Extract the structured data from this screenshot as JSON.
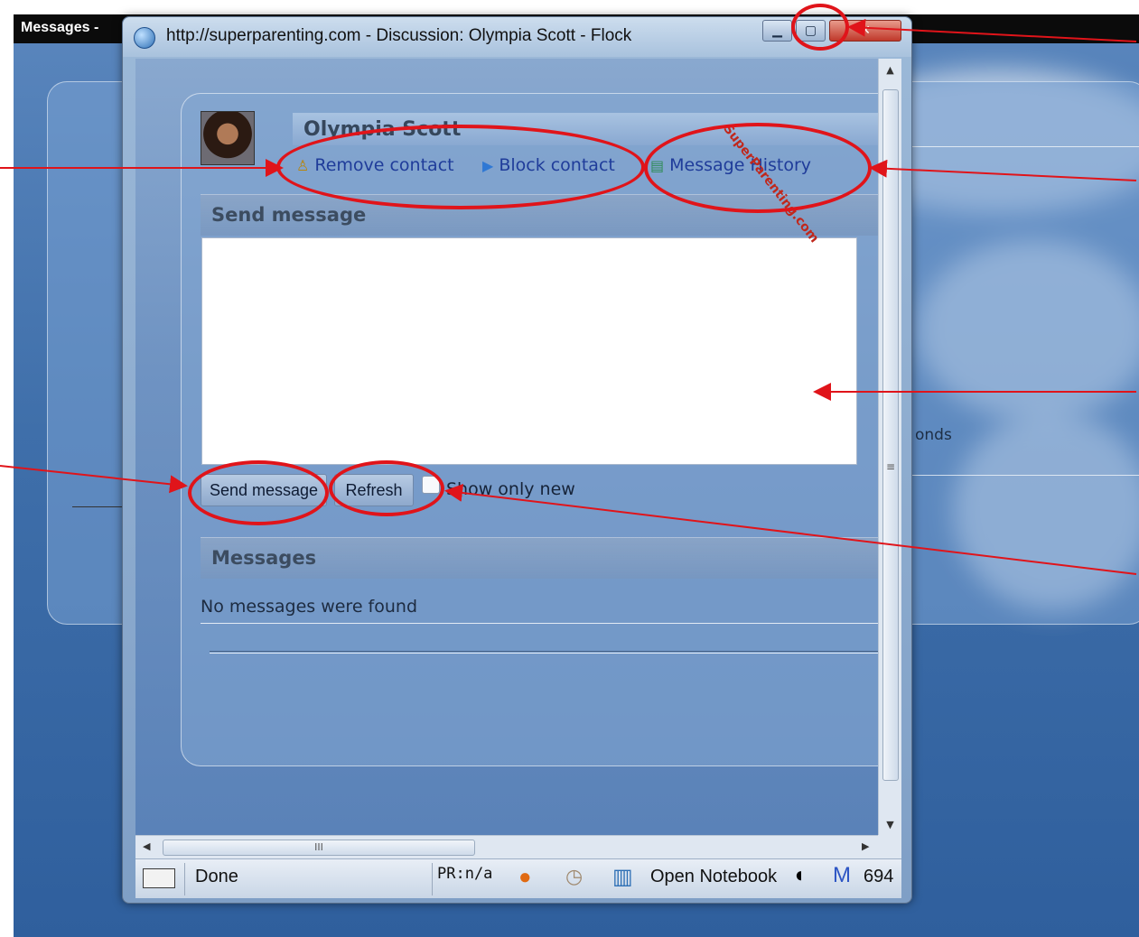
{
  "background_window": {
    "title": "Messages -",
    "text_fragment": "onds"
  },
  "window": {
    "title": "http://superparenting.com - Discussion: Olympia Scott - Flock",
    "buttons": [
      "minimize",
      "maximize",
      "close"
    ]
  },
  "contact": {
    "name": "Olympia Scott",
    "actions": [
      {
        "label": "Remove contact",
        "icon": "remove-contact-icon"
      },
      {
        "label": "Block contact",
        "icon": "block-icon"
      },
      {
        "label": "Message History",
        "icon": "history-icon"
      }
    ]
  },
  "compose": {
    "section_title": "Send message",
    "message_value": "",
    "send_button": "Send message",
    "refresh_button": "Refresh",
    "show_only_new_label": "Show only new",
    "show_only_new_checked": false
  },
  "messages": {
    "section_title": "Messages",
    "empty_text": "No messages were found"
  },
  "scrollbar": {
    "grip_vertical": "≡",
    "grip_horizontal": "III"
  },
  "statusbar": {
    "status": "Done",
    "pagerank": "PR:n/a",
    "notebook": "Open Notebook",
    "mail_count": "694"
  },
  "watermark": "SuperParenting.com",
  "annotation_color": "#e0141a"
}
